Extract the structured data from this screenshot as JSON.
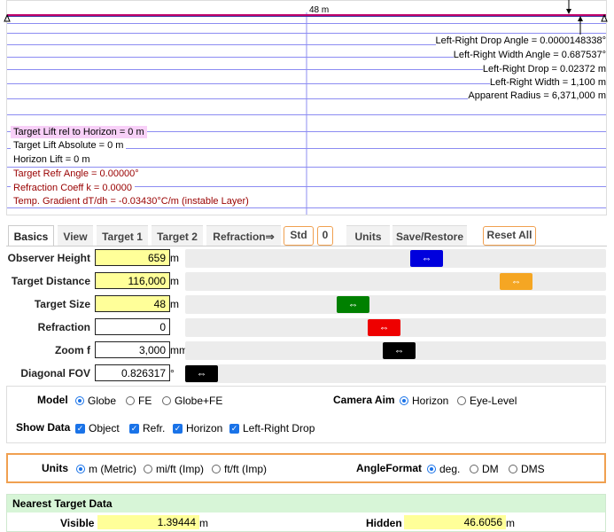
{
  "graphic": {
    "top_label": "48 m",
    "right_info": [
      "Left-Right Drop Angle = 0.0000148338°",
      "Left-Right Width Angle = 0.687537°",
      "Left-Right Drop = 0.02372 m",
      "Left-Right Width = 1,100 m",
      "Apparent Radius = 6,371,000 m"
    ],
    "left_info": [
      "Target Lift rel to Horizon = 0 m",
      "Target Lift Absolute = 0 m",
      "Horizon Lift = 0 m",
      "Target Refr Angle = 0.00000°",
      "Refraction Coeff k = 0.0000",
      "Temp. Gradient dT/dh = -0.03430°C/m (instable Layer)"
    ],
    "colors": {
      "line": "#8080f0",
      "target": "#c0006a",
      "info_red": "#990000",
      "highlight": "#f8d0f8"
    }
  },
  "tabs": [
    {
      "label": "Basics",
      "active": true
    },
    {
      "label": "View"
    },
    {
      "label": "Target 1"
    },
    {
      "label": "Target 2"
    },
    {
      "label": "Refraction⇒"
    },
    {
      "label": "Std",
      "orange": true
    },
    {
      "label": "0",
      "orange": true
    },
    {
      "label": "Units"
    },
    {
      "label": "Save/Restore"
    },
    {
      "label": "Reset All",
      "orange": true
    }
  ],
  "sliders": [
    {
      "label": "Observer Height",
      "value": "659",
      "unit": "m",
      "yellow": true,
      "knob_color": "#0000dd",
      "knob_pos": 0.58,
      "knob": "⇔"
    },
    {
      "label": "Target Distance",
      "value": "116,000",
      "unit": "m",
      "yellow": true,
      "knob_color": "#f5a623",
      "knob_pos": 0.81,
      "knob": "⇔"
    },
    {
      "label": "Target Size",
      "value": "48",
      "unit": "m",
      "yellow": true,
      "knob_color": "#008000",
      "knob_pos": 0.39,
      "knob": "⇔"
    },
    {
      "label": "Refraction",
      "value": "0",
      "unit": "",
      "yellow": false,
      "knob_color": "#ee0000",
      "knob_pos": 0.47,
      "knob": "⇔"
    },
    {
      "label": "Zoom f",
      "value": "3,000",
      "unit": "mm",
      "yellow": false,
      "knob_color": "#000000",
      "knob_pos": 0.51,
      "knob": "⇔"
    },
    {
      "label": "Diagonal FOV",
      "value": "0.826317",
      "unit": "°",
      "yellow": false,
      "knob_color": "#000000",
      "knob_pos": 0.0,
      "knob": "⇔"
    }
  ],
  "model": {
    "label": "Model",
    "options": [
      {
        "label": "Globe",
        "checked": true
      },
      {
        "label": "FE",
        "checked": false
      },
      {
        "label": "Globe+FE",
        "checked": false
      }
    ]
  },
  "camera_aim": {
    "label": "Camera Aim",
    "options": [
      {
        "label": "Horizon",
        "checked": true
      },
      {
        "label": "Eye-Level",
        "checked": false
      }
    ]
  },
  "show_data": {
    "label": "Show Data",
    "options": [
      {
        "label": "Object",
        "checked": true
      },
      {
        "label": "Refr.",
        "checked": true
      },
      {
        "label": "Horizon",
        "checked": true
      },
      {
        "label": "Left-Right Drop",
        "checked": true
      }
    ]
  },
  "units": {
    "label": "Units",
    "options": [
      {
        "label": "m (Metric)",
        "checked": true
      },
      {
        "label": "mi/ft (Imp)",
        "checked": false
      },
      {
        "label": "ft/ft (Imp)",
        "checked": false
      }
    ]
  },
  "angle_format": {
    "label": "AngleFormat",
    "options": [
      {
        "label": "deg.",
        "checked": true
      },
      {
        "label": "DM",
        "checked": false
      },
      {
        "label": "DMS",
        "checked": false
      }
    ]
  },
  "nearest": {
    "title": "Nearest Target Data",
    "visible_label": "Visible",
    "visible_value": "1.39444",
    "visible_unit": "m",
    "hidden_label": "Hidden",
    "hidden_value": "46.6056",
    "hidden_unit": "m"
  },
  "accent": "#1a73e8",
  "panel_border_orange": "#f0a050"
}
